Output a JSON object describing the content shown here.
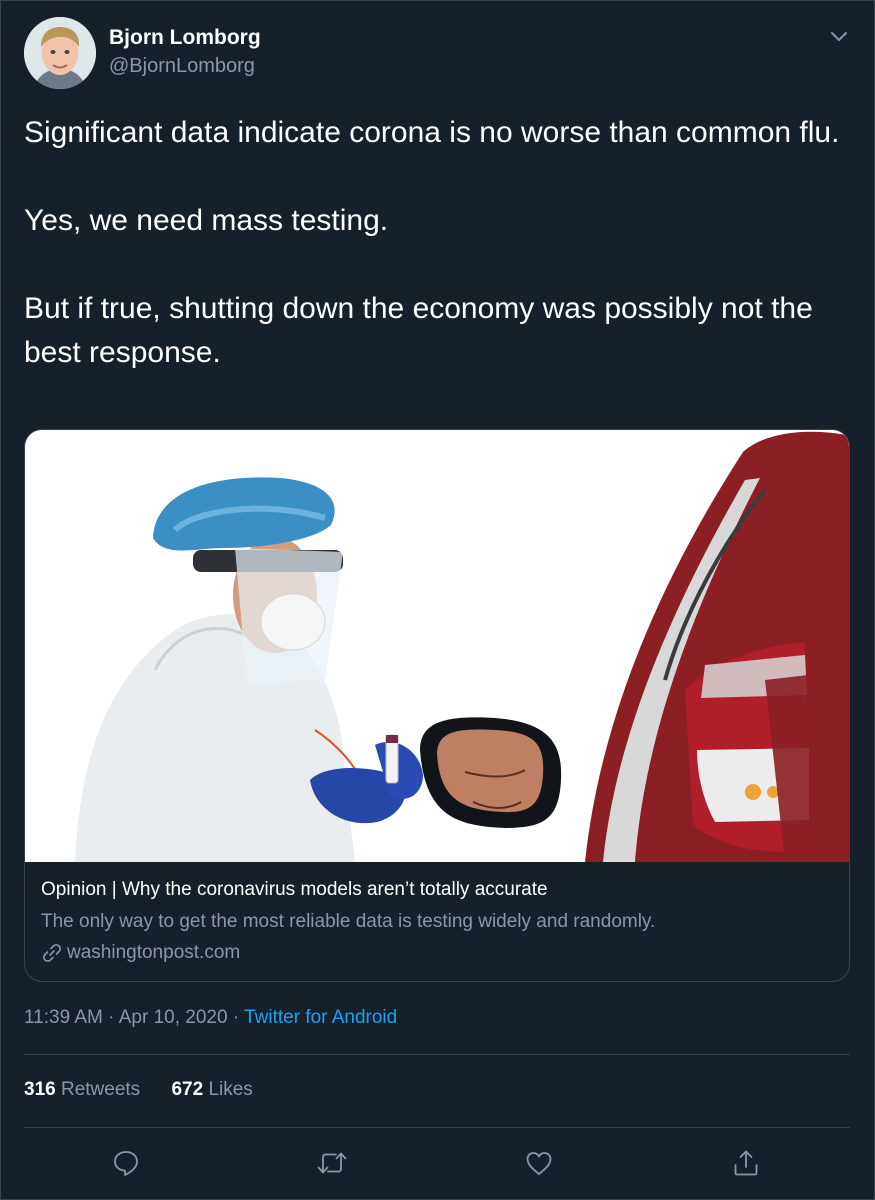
{
  "author": {
    "display_name": "Bjorn Lomborg",
    "handle": "@BjornLomborg"
  },
  "tweet": {
    "paragraphs": [
      "Significant data indicate corona is no worse than common flu.",
      "Yes, we need mass testing.",
      "But if true, shutting down the economy was possibly not the best response."
    ]
  },
  "card": {
    "title": "Opinion | Why the coronavirus models aren’t totally accurate",
    "description": "The only way to get the most reliable data is testing widely and randomly.",
    "domain": "washingtonpost.com"
  },
  "meta": {
    "time": "11:39 AM",
    "separator1": " · ",
    "date": "Apr 10, 2020",
    "separator2": " · ",
    "source": "Twitter for Android"
  },
  "stats": {
    "retweets_count": "316",
    "retweets_label": "Retweets",
    "likes_count": "672",
    "likes_label": "Likes"
  },
  "icons": {
    "caret": "chevron-down-icon",
    "link": "link-icon",
    "reply": "reply-icon",
    "retweet": "retweet-icon",
    "like": "heart-icon",
    "share": "share-icon"
  },
  "colors": {
    "background": "#15202b",
    "text": "#ffffff",
    "secondary": "#8899a6",
    "accent": "#1da1f2",
    "border": "#38444d"
  }
}
